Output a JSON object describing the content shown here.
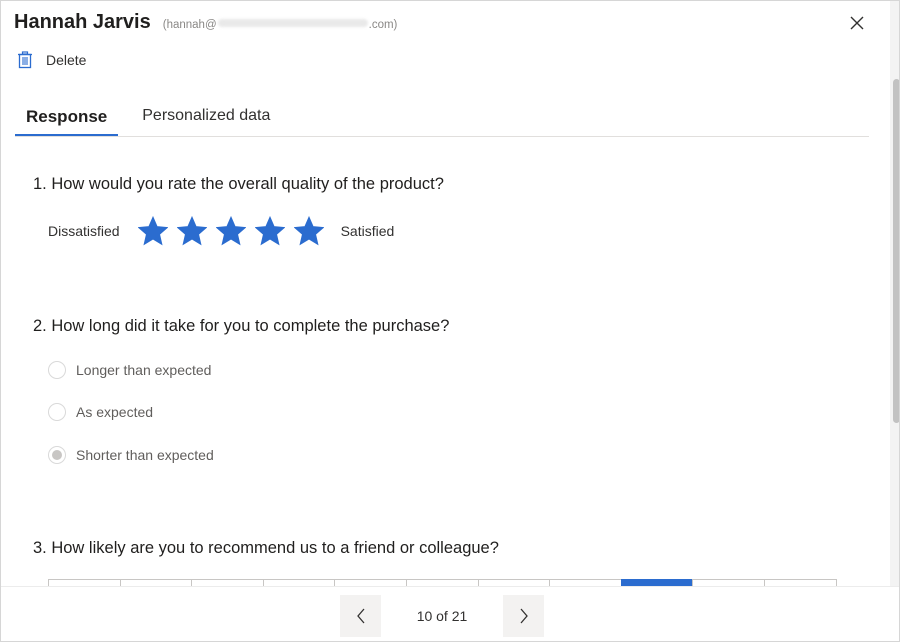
{
  "header": {
    "name": "Hannah Jarvis",
    "email_prefix": "(hannah@",
    "email_suffix": ".com)"
  },
  "toolbar": {
    "delete_label": "Delete"
  },
  "tabs": [
    {
      "label": "Response",
      "active": true
    },
    {
      "label": "Personalized data",
      "active": false
    }
  ],
  "questions": [
    {
      "title": "1. How would you rate the overall quality of the product?",
      "type": "rating",
      "low_label": "Dissatisfied",
      "high_label": "Satisfied",
      "stars_total": 5,
      "stars_filled": 5,
      "star_color": "#2b6ccf"
    },
    {
      "title": "2. How long did it take for you to complete the purchase?",
      "type": "choice",
      "options": [
        {
          "label": "Longer than expected",
          "selected": false
        },
        {
          "label": "As expected",
          "selected": false
        },
        {
          "label": "Shorter than expected",
          "selected": true
        }
      ]
    },
    {
      "title": "3. How likely are you to recommend us to a friend or colleague?",
      "type": "nps",
      "scale_count": 11,
      "selected_index": 8,
      "selected_color": "#2b6ccf"
    }
  ],
  "footer": {
    "pager_text": "10 of 21"
  },
  "colors": {
    "accent": "#2b6ccf",
    "text": "#323130",
    "muted": "#605e5c"
  },
  "icons": {
    "close": "close-icon",
    "delete": "trash-icon",
    "prev": "chevron-left-icon",
    "next": "chevron-right-icon",
    "star": "star-icon"
  }
}
